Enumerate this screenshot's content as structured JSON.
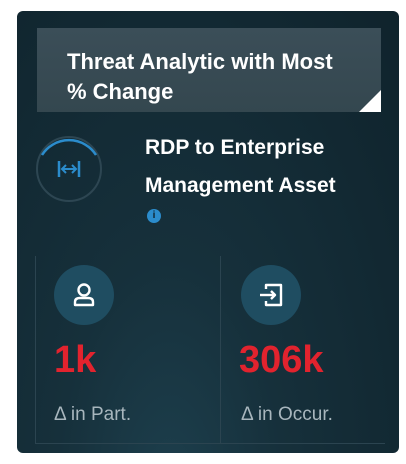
{
  "widget": {
    "title": "Threat Analytic with Most % Change",
    "analytic_name": "RDP to Enterprise Management Asset",
    "analytic_icon": "horizontal-arrows-icon",
    "info_icon": "info-icon",
    "info_symbol": "i"
  },
  "stats": [
    {
      "icon": "user-icon",
      "value": "1k",
      "label": "Δ in Part."
    },
    {
      "icon": "exit-arrow-icon",
      "value": "306k",
      "label": "Δ in Occur."
    }
  ],
  "colors": {
    "card_background": "#16303b",
    "accent_blue": "#2b8ccc",
    "value_red": "#e2232e",
    "label_gray": "#a8b6bd"
  }
}
